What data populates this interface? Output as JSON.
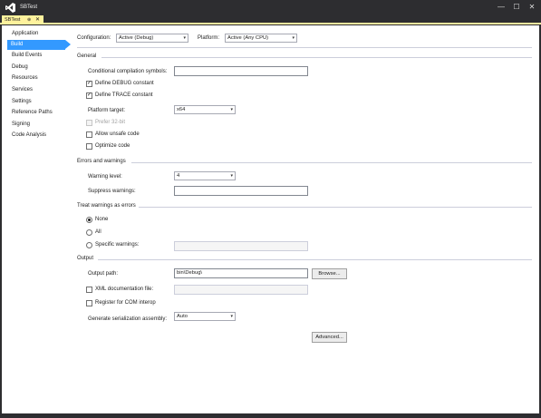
{
  "window": {
    "title": "SBTest",
    "minimize_glyph": "—",
    "maximize_glyph": "☐",
    "close_glyph": "✕"
  },
  "tab": {
    "label": "SBTest",
    "pin_glyph": "⊕",
    "close_glyph": "✕"
  },
  "nav": {
    "items": [
      {
        "label": "Application"
      },
      {
        "label": "Build"
      },
      {
        "label": "Build Events"
      },
      {
        "label": "Debug"
      },
      {
        "label": "Resources"
      },
      {
        "label": "Services"
      },
      {
        "label": "Settings"
      },
      {
        "label": "Reference Paths"
      },
      {
        "label": "Signing"
      },
      {
        "label": "Code Analysis"
      }
    ],
    "selected": "Build"
  },
  "top": {
    "configuration_label": "Configuration:",
    "configuration_value": "Active (Debug)",
    "platform_label": "Platform:",
    "platform_value": "Active (Any CPU)"
  },
  "general": {
    "header": "General",
    "conditional_symbols_label": "Conditional compilation symbols:",
    "conditional_symbols_value": "",
    "define_debug": {
      "label": "Define DEBUG constant",
      "checked": true
    },
    "define_trace": {
      "label": "Define TRACE constant",
      "checked": true
    },
    "platform_target_label": "Platform target:",
    "platform_target_value": "x64",
    "prefer_32bit": {
      "label": "Prefer 32-bit",
      "checked": false,
      "enabled": false
    },
    "allow_unsafe": {
      "label": "Allow unsafe code",
      "checked": false
    },
    "optimize": {
      "label": "Optimize code",
      "checked": false
    }
  },
  "errors": {
    "header": "Errors and warnings",
    "warning_level_label": "Warning level:",
    "warning_level_value": "4",
    "suppress_label": "Suppress warnings:",
    "suppress_value": ""
  },
  "treat": {
    "header": "Treat warnings as errors",
    "none_label": "None",
    "all_label": "All",
    "specific_label": "Specific warnings:",
    "selected": "None",
    "specific_value": ""
  },
  "output": {
    "header": "Output",
    "path_label": "Output path:",
    "path_value": "bin\\Debug\\",
    "browse_label": "Browse...",
    "xml_doc": {
      "label": "XML documentation file:",
      "checked": false
    },
    "xml_doc_value": "",
    "com_interop": {
      "label": "Register for COM interop",
      "checked": false
    },
    "serialization_label": "Generate serialization assembly:",
    "serialization_value": "Auto",
    "advanced_label": "Advanced..."
  },
  "icons": {
    "dropdown": "▾",
    "check": "✓"
  },
  "colors": {
    "accent": "#3399ff",
    "tab": "#fff29d",
    "chrome": "#2d2d30"
  }
}
